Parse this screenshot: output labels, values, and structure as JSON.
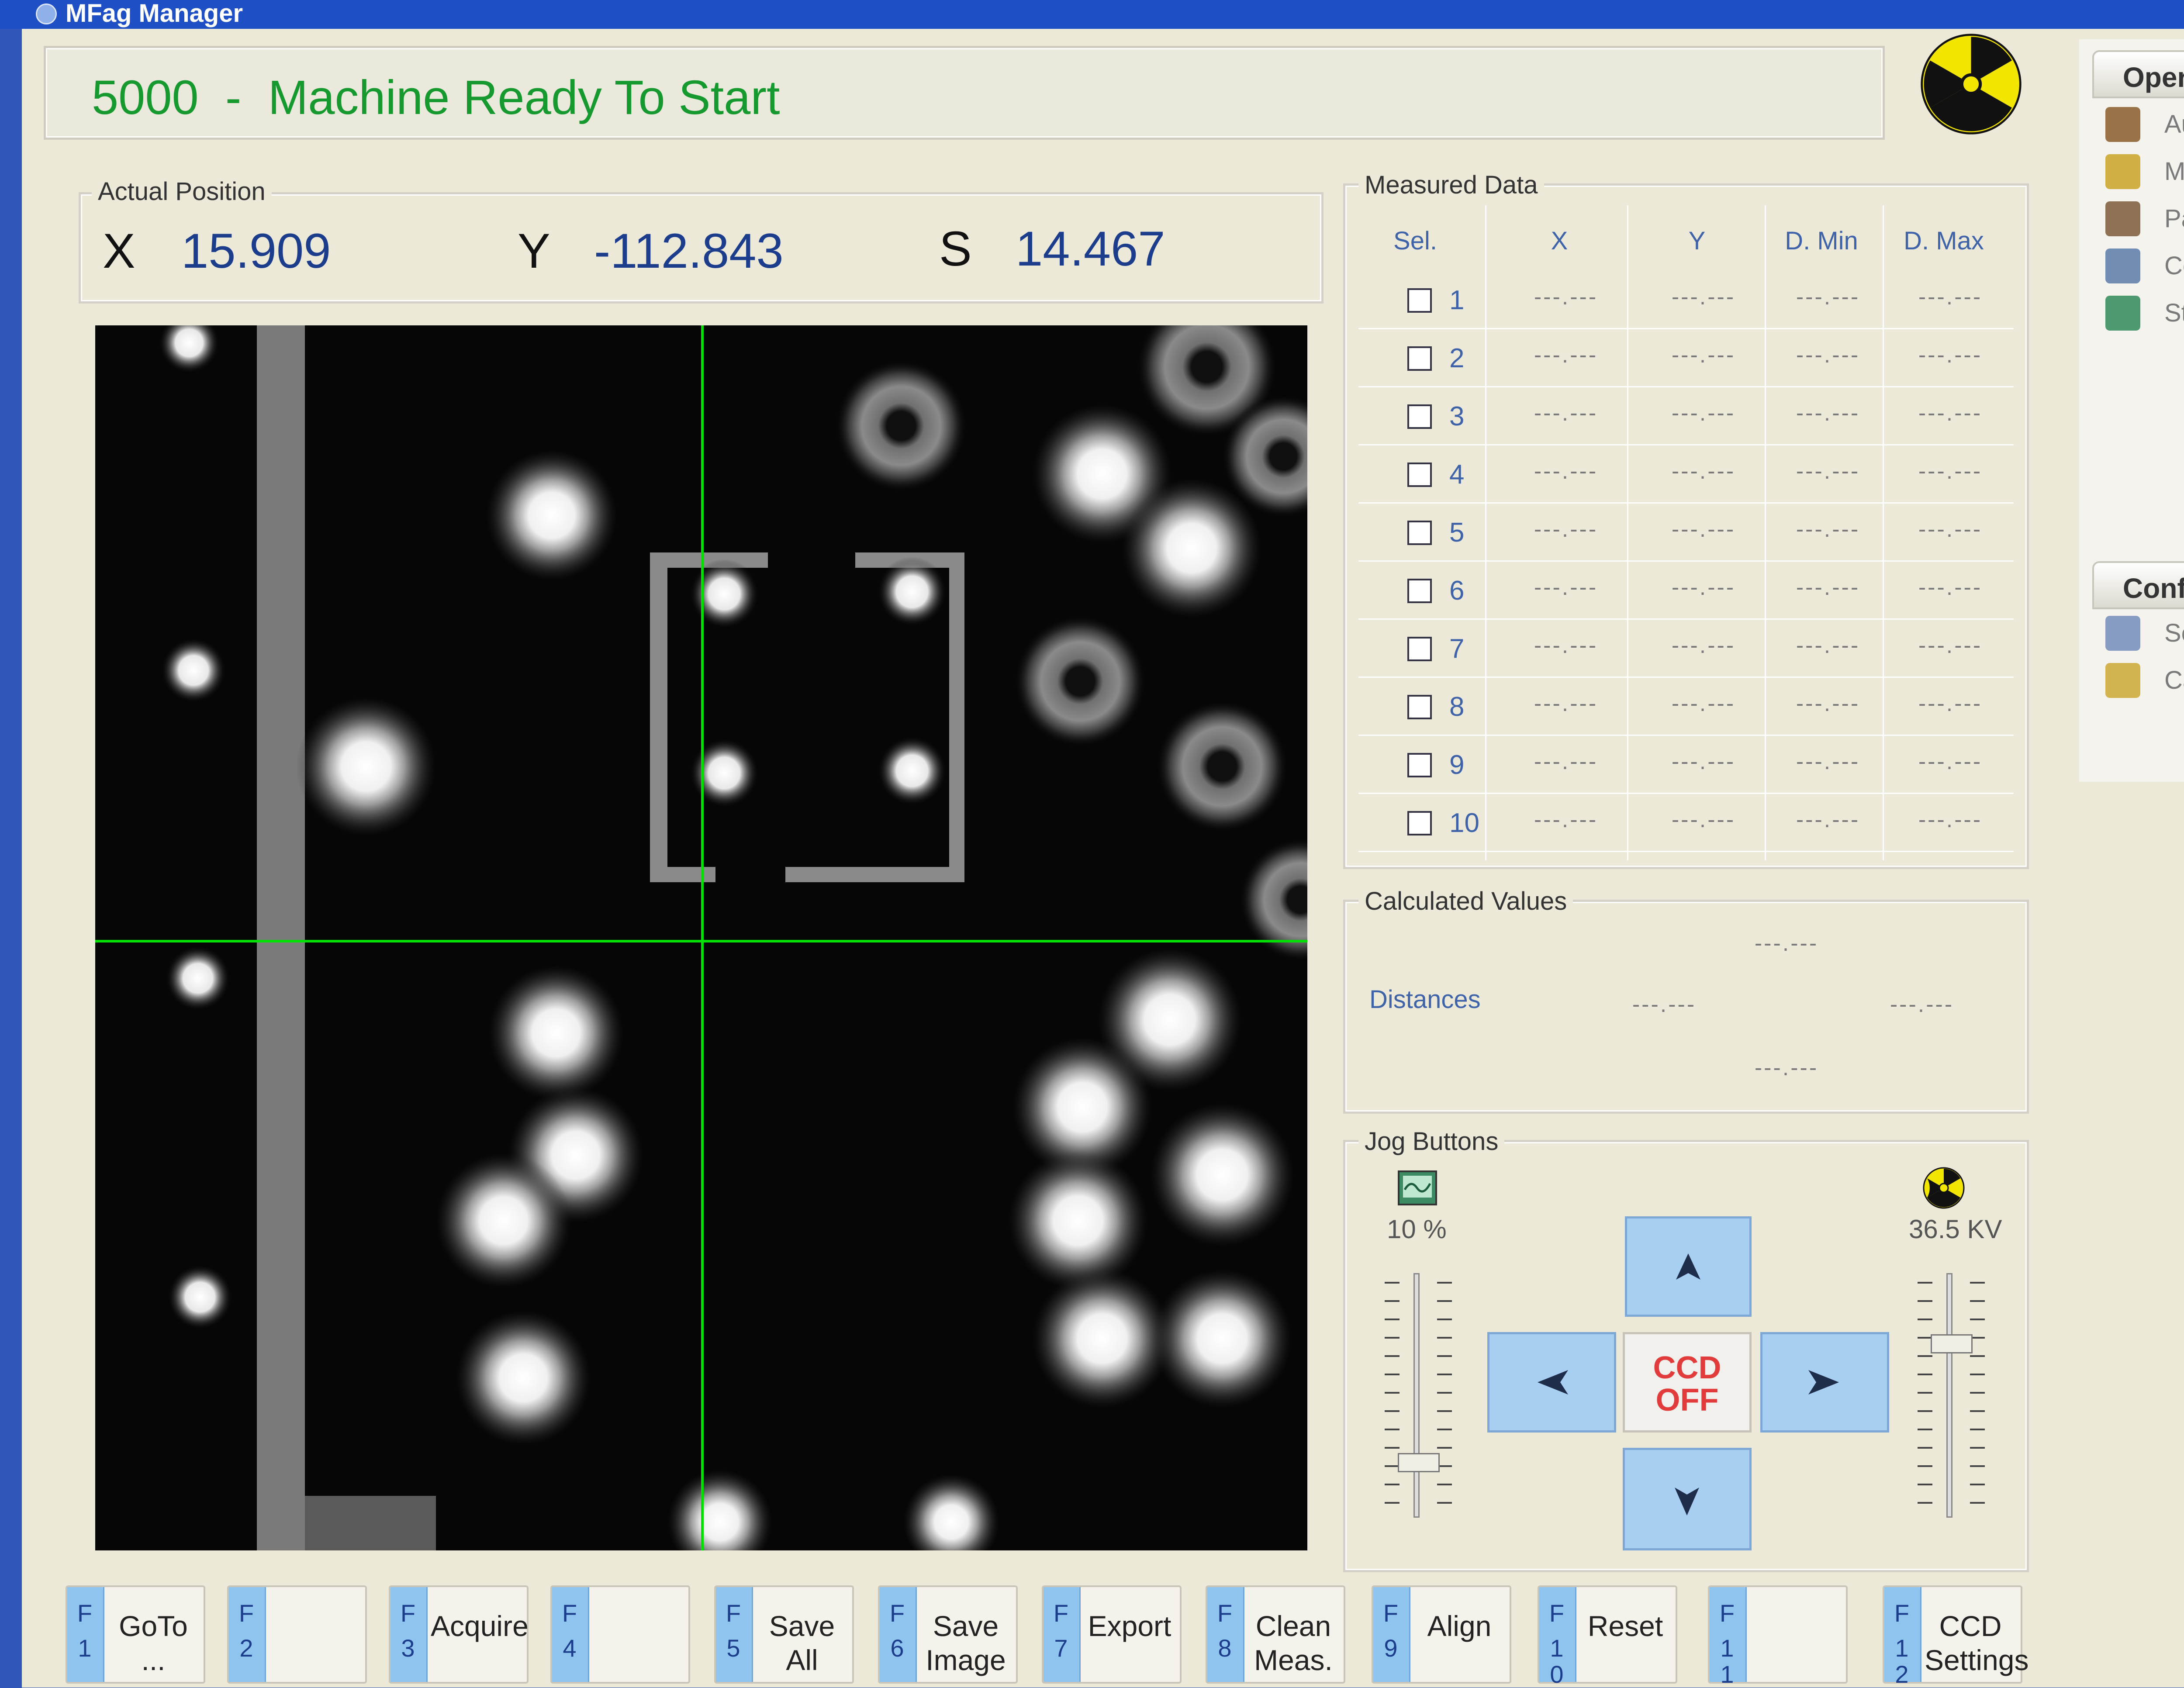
{
  "window": {
    "title": "MFag Manager"
  },
  "status": {
    "code": "5000",
    "separator": "-",
    "message": "Machine Ready To Start"
  },
  "actual_position": {
    "legend": "Actual Position",
    "x_label": "X",
    "x_value": "15.909",
    "y_label": "Y",
    "y_value": "-112.843",
    "s_label": "S",
    "s_value": "14.467"
  },
  "measured_data": {
    "legend": "Measured Data",
    "headers": [
      "Sel.",
      "X",
      "Y",
      "D. Min",
      "D. Max"
    ],
    "rows": [
      {
        "num": "1",
        "x": "---.---",
        "y": "---.---",
        "dmin": "---.---",
        "dmax": "---.---"
      },
      {
        "num": "2",
        "x": "---.---",
        "y": "---.---",
        "dmin": "---.---",
        "dmax": "---.---"
      },
      {
        "num": "3",
        "x": "---.---",
        "y": "---.---",
        "dmin": "---.---",
        "dmax": "---.---"
      },
      {
        "num": "4",
        "x": "---.---",
        "y": "---.---",
        "dmin": "---.---",
        "dmax": "---.---"
      },
      {
        "num": "5",
        "x": "---.---",
        "y": "---.---",
        "dmin": "---.---",
        "dmax": "---.---"
      },
      {
        "num": "6",
        "x": "---.---",
        "y": "---.---",
        "dmin": "---.---",
        "dmax": "---.---"
      },
      {
        "num": "7",
        "x": "---.---",
        "y": "---.---",
        "dmin": "---.---",
        "dmax": "---.---"
      },
      {
        "num": "8",
        "x": "---.---",
        "y": "---.---",
        "dmin": "---.---",
        "dmax": "---.---"
      },
      {
        "num": "9",
        "x": "---.---",
        "y": "---.---",
        "dmin": "---.---",
        "dmax": "---.---"
      },
      {
        "num": "10",
        "x": "---.---",
        "y": "---.---",
        "dmin": "---.---",
        "dmax": "---.---"
      }
    ]
  },
  "calculated_values": {
    "legend": "Calculated Values",
    "distances_label": "Distances",
    "top": "---.---",
    "left": "---.---",
    "right": "---.---",
    "bottom": "---.---"
  },
  "jog": {
    "legend": "Jog Buttons",
    "intensity": "10 %",
    "intensity_level": 0.1,
    "kv": "36.5 KV",
    "ccd_line1": "CCD",
    "ccd_line2": "OFF"
  },
  "right_panel": {
    "operations_title": "Operati",
    "operations_items": [
      "Autom",
      "Manual",
      "Pattern",
      "Counte",
      "Statist"
    ],
    "config_title": "Configu",
    "config_items": [
      "Setting",
      "Calibra"
    ]
  },
  "fkeys": [
    {
      "f": "F",
      "n": "1",
      "label": "GoTo ..."
    },
    {
      "f": "F",
      "n": "2",
      "label": ""
    },
    {
      "f": "F",
      "n": "3",
      "label": "Acquire"
    },
    {
      "f": "F",
      "n": "4",
      "label": ""
    },
    {
      "f": "F",
      "n": "5",
      "label": "Save All"
    },
    {
      "f": "F",
      "n": "6",
      "label": "Save Image"
    },
    {
      "f": "F",
      "n": "7",
      "label": "Export"
    },
    {
      "f": "F",
      "n": "8",
      "label": "Clean Meas."
    },
    {
      "f": "F",
      "n": "9",
      "label": "Align"
    },
    {
      "f": "F",
      "n": "10",
      "label": "Reset"
    },
    {
      "f": "F",
      "n": "11",
      "label": ""
    },
    {
      "f": "F",
      "n": "12",
      "label": "CCD Settings"
    }
  ],
  "colors": {
    "status_text": "#169a2f",
    "crosshair": "#00e000",
    "jog_button": "#a8cff2",
    "ccd_off": "#e23b3b",
    "radiation_yellow": "#f2e600"
  }
}
